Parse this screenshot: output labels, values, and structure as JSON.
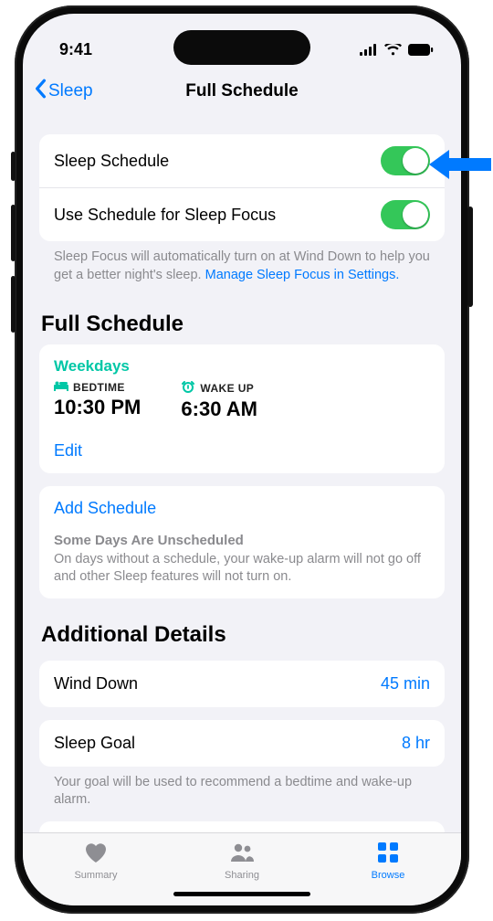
{
  "status": {
    "time": "9:41"
  },
  "nav": {
    "back": "Sleep",
    "title": "Full Schedule"
  },
  "toggles": {
    "sleep_schedule_label": "Sleep Schedule",
    "use_focus_label": "Use Schedule for Sleep Focus",
    "footer_pre": "Sleep Focus will automatically turn on at Wind Down to help you get a better night's sleep. ",
    "footer_link": "Manage Sleep Focus in Settings."
  },
  "full_schedule": {
    "heading": "Full Schedule",
    "day_group": "Weekdays",
    "bedtime_label": "BEDTIME",
    "bedtime_value": "10:30 PM",
    "wake_label": "WAKE UP",
    "wake_value": "6:30 AM",
    "edit": "Edit",
    "add": "Add Schedule",
    "unscheduled_title": "Some Days Are Unscheduled",
    "unscheduled_text": "On days without a schedule, your wake-up alarm will not go off and other Sleep features will not turn on."
  },
  "details": {
    "heading": "Additional Details",
    "wind_down_label": "Wind Down",
    "wind_down_value": "45 min",
    "sleep_goal_label": "Sleep Goal",
    "sleep_goal_value": "8 hr",
    "goal_footer": "Your goal will be used to recommend a bedtime and wake-up alarm."
  },
  "tabs": {
    "summary": "Summary",
    "sharing": "Sharing",
    "browse": "Browse"
  }
}
